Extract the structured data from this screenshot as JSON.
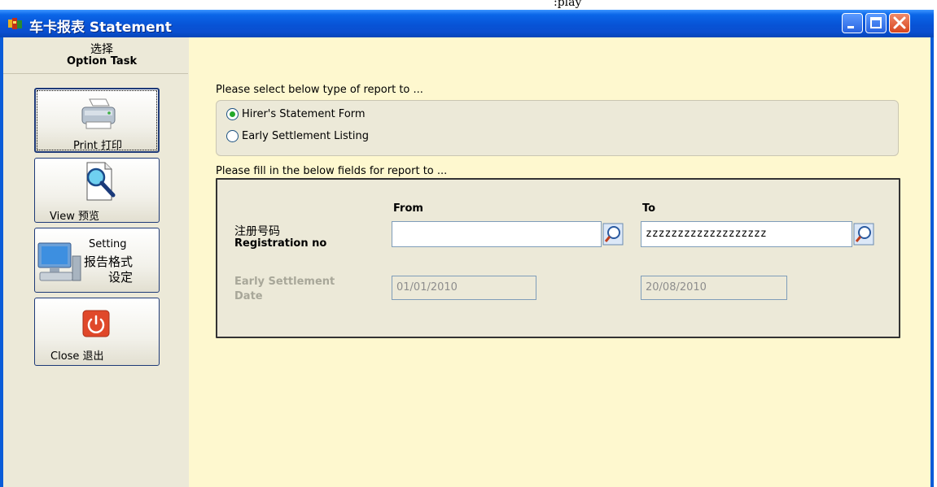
{
  "window": {
    "title": "车卡报表 Statement"
  },
  "sidebar": {
    "header_cn": "选择",
    "header_en": "Option Task",
    "buttons": [
      {
        "label": "Print 打印",
        "icon": "printer-icon"
      },
      {
        "label": "View 预览",
        "icon": "magnifier-icon"
      },
      {
        "label_line1": "Setting",
        "label_line2": "报告格式",
        "label_line3": "设定",
        "icon": "computer-icon"
      },
      {
        "label": "Close 退出",
        "icon": "power-icon"
      }
    ]
  },
  "report_type": {
    "prompt": "Please select below type of report to ...",
    "options": [
      {
        "label": "Hirer's Statement Form",
        "selected": true
      },
      {
        "label": "Early Settlement Listing",
        "selected": false
      }
    ]
  },
  "fields": {
    "prompt": "Please fill in the below fields for report to ...",
    "from_header": "From",
    "to_header": "To",
    "registration_cn": "注册号码",
    "registration_en": "Registration no",
    "registration_from": "",
    "registration_to": "zzzzzzzzzzzzzzzzzzz",
    "early_settlement_label_line1": "Early Settlement",
    "early_settlement_label_line2": "Date",
    "date_from": "01/01/2010",
    "date_to": "20/08/2010"
  },
  "colors": {
    "titlebar": "#0A56D8",
    "main_bg": "#FEF8CF",
    "panel_bg": "#ECE9D8",
    "radio_dot": "#23A829",
    "close_red": "#D8451E"
  }
}
